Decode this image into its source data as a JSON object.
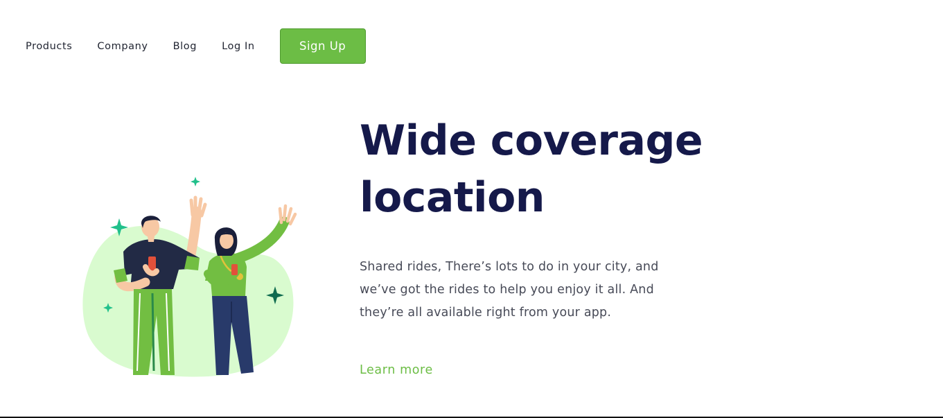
{
  "nav": {
    "items": [
      {
        "label": "Products"
      },
      {
        "label": "Company"
      },
      {
        "label": "Blog"
      },
      {
        "label": "Log In"
      }
    ],
    "signup_label": "Sign Up"
  },
  "hero": {
    "headline_line1": "Wide coverage",
    "headline_line2": "location",
    "body_line1": "Shared rides, There’s lots to do in your city, and",
    "body_line2": "we’ve got the rides to help you enjoy it all. And",
    "body_line3": "they’re all available right from your app.",
    "learn_more": "Learn more"
  },
  "colors": {
    "accent_green": "#6cbd45",
    "headline_navy": "#15194a",
    "blob_green": "#d9fbcf"
  },
  "illustration": {
    "icon": "two-people-waving-illustration"
  }
}
